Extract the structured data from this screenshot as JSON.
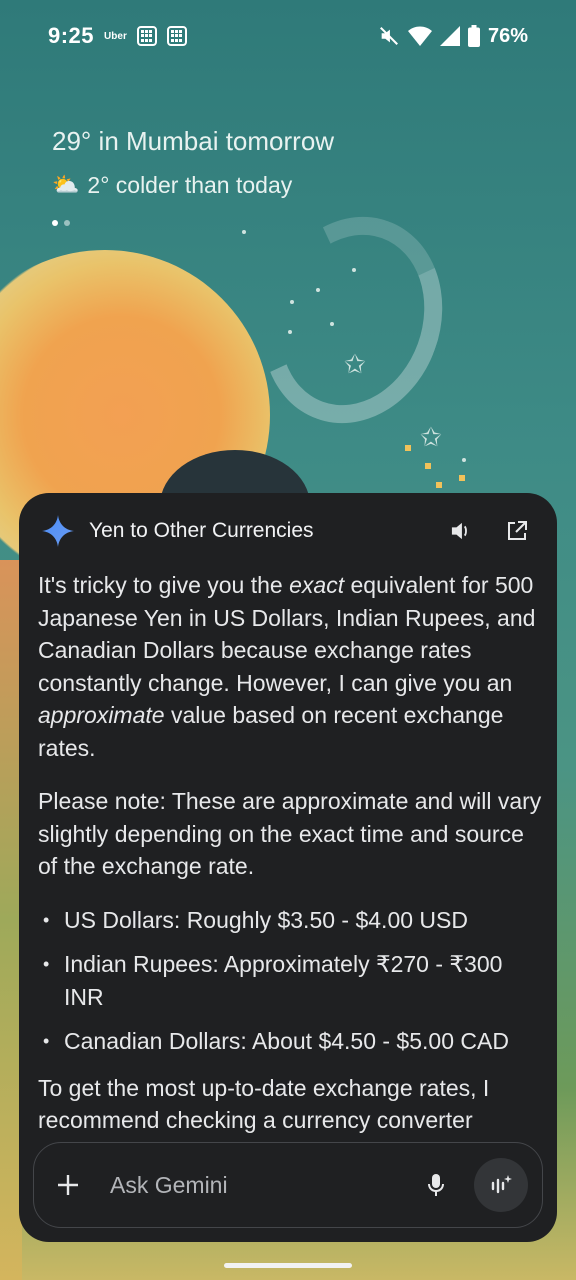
{
  "status_bar": {
    "time": "9:25",
    "app_label": "Uber",
    "battery": "76%",
    "icons": [
      "grid-app-icon",
      "grid-app-icon",
      "mute-icon",
      "wifi-icon",
      "signal-icon",
      "battery-icon"
    ]
  },
  "weather": {
    "headline": "29° in Mumbai tomorrow",
    "sub": "2° colder than today",
    "icon": "partly-cloudy-icon"
  },
  "card": {
    "title": "Yen to Other Currencies",
    "icons": [
      "gemini-spark-icon",
      "speaker-icon",
      "open-external-icon"
    ],
    "para1_a": "It's tricky to give you the ",
    "para1_em1": "exact",
    "para1_b": " equivalent for 500 Japanese Yen in US Dollars, Indian Rupees, and Canadian Dollars because exchange rates constantly change. However, I can give you an ",
    "para1_em2": "approximate",
    "para1_c": " value based on recent exchange rates.",
    "para2": "Please note: These are approximate and will vary slightly depending on the exact time and source of the exchange rate.",
    "bullets": [
      "US Dollars: Roughly $3.50 - $4.00 USD",
      "Indian Rupees: Approximately ₹270 - ₹300 INR",
      "Canadian Dollars: About $4.50 - $5.00 CAD"
    ],
    "para3": "To get the most up-to-date exchange rates, I recommend checking a currency converter"
  },
  "input": {
    "placeholder": "Ask Gemini",
    "value": "",
    "icons": [
      "plus-icon",
      "mic-icon",
      "live-icon"
    ]
  },
  "colors": {
    "card_bg": "#1f2022",
    "accent_blue": "#4c8df6",
    "text": "#e7e8ea"
  }
}
